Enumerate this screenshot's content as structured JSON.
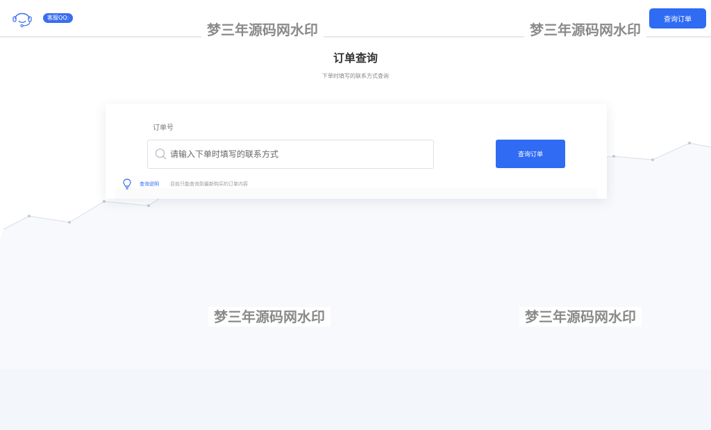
{
  "header": {
    "support_icon": "headset-icon",
    "qq_label": "客服QQ:",
    "query_order_button": "查询订单"
  },
  "watermarks": [
    "梦三年源码网水印",
    "梦三年源码网水印",
    "梦三年源码网水印",
    "梦三年源码网水印"
  ],
  "main": {
    "title": "订单查询",
    "subtitle": "下单时填写的联系方式查询"
  },
  "form": {
    "field_label": "订单号",
    "search_icon": "search-icon",
    "search_placeholder": "请输入下单时填写的联系方式",
    "search_value": "",
    "submit_label": "查询订单"
  },
  "tip": {
    "icon": "lightbulb-icon",
    "link_label": "查询说明",
    "text": "目前只能查询到最新购买的订单内容"
  },
  "colors": {
    "accent": "#2f6bf3",
    "background_band": "#f3f6fb"
  }
}
